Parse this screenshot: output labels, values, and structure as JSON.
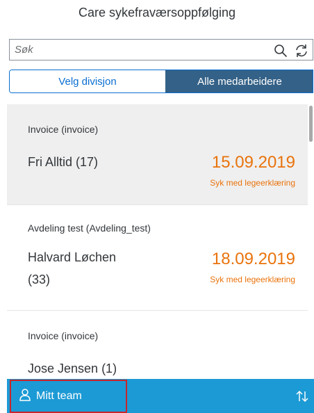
{
  "header": {
    "title": "Care sykefraværsoppfølging"
  },
  "search": {
    "placeholder": "Søk",
    "value": ""
  },
  "segments": [
    {
      "label": "Velg divisjon",
      "active": false
    },
    {
      "label": "Alle medarbeidere",
      "active": true
    }
  ],
  "list": {
    "items": [
      {
        "department": "Invoice (invoice)",
        "name": "Fri Alltid (17)",
        "date": "15.09.2019",
        "status": "Syk med legeerklæring",
        "selected": true
      },
      {
        "department": "Avdeling test (Avdeling_test)",
        "name_line1": "Halvard Løchen",
        "name_line2": "(33)",
        "date": "18.09.2019",
        "status": "Syk med legeerklæring",
        "selected": false
      },
      {
        "department": "Invoice (invoice)",
        "name": "Jose Jensen (1)"
      }
    ]
  },
  "footer": {
    "team_label": "Mitt team"
  },
  "colors": {
    "accent": "#e9730c",
    "footer_bg": "#1c9ad5",
    "segment_active_bg": "#346187",
    "highlight_border": "#c9252c"
  },
  "icons": {
    "search": "search-icon",
    "refresh": "refresh-icon",
    "person": "person-icon",
    "sort": "sort-icon"
  }
}
